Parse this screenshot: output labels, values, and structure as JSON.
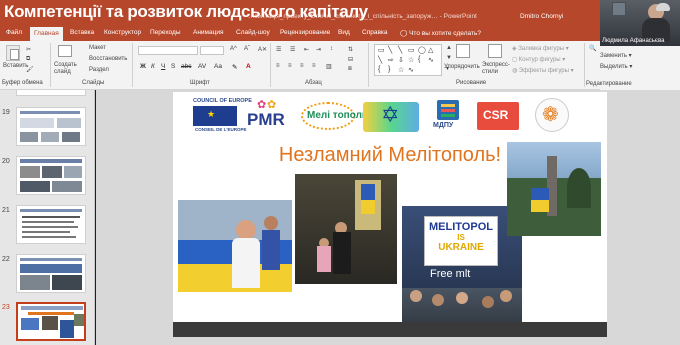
{
  "meeting": {
    "title": "Компетенції та розвиток людського капіталу"
  },
  "titlebar": {
    "doc_title": "…зентація_проекту_Етнічні_спільноти_і_спільність_запоруж… - PowerPoint",
    "user": "Dmitro Chornyi",
    "controls": [
      "–",
      "□",
      "✕"
    ]
  },
  "webcam": {
    "participant": "Людмила Афанасьєва"
  },
  "tabs": [
    {
      "label": "Файл"
    },
    {
      "label": "Главная"
    },
    {
      "label": "Вставка"
    },
    {
      "label": "Конструктор"
    },
    {
      "label": "Переходы"
    },
    {
      "label": "Анимация"
    },
    {
      "label": "Слайд-шоу"
    },
    {
      "label": "Рецензирование"
    },
    {
      "label": "Вид"
    },
    {
      "label": "Справка"
    },
    {
      "label": "Что вы хотите сделать?"
    }
  ],
  "ribbon": {
    "clipboard": {
      "paste": "Вставить",
      "group": "Буфер обмена"
    },
    "slides": {
      "new": "Создать слайд",
      "layout": "Макет",
      "reset": "Восстановить",
      "section": "Раздел",
      "group": "Слайды"
    },
    "font": {
      "group": "Шрифт",
      "buttons": [
        "Ж",
        "К",
        "Ч",
        "S",
        "abc",
        "AV",
        "Aa"
      ]
    },
    "paragraph": {
      "group": "Абзац"
    },
    "drawing": {
      "arrange": "Упорядочить",
      "styles": "Экспресс-стили",
      "fill": "Заливка фигуры",
      "outline": "Контур фигуры",
      "effects": "Эффекты фигуры",
      "group": "Рисование"
    },
    "editing": {
      "find": "Найти",
      "replace": "Заменить",
      "select": "Выделить",
      "group": "Редактирование"
    }
  },
  "thumbnails": [
    {
      "number": "19",
      "current": false
    },
    {
      "number": "20",
      "current": false
    },
    {
      "number": "21",
      "current": false
    },
    {
      "number": "22",
      "current": false
    },
    {
      "number": "23",
      "current": true
    }
  ],
  "slide": {
    "heading": "Незламний Мелітополь!",
    "logos": {
      "council": "COUNCIL OF EUROPE",
      "council_fr": "CONSEIL DE L'EUROPE",
      "pmr": "PMR",
      "melitopol": "Мелі тополь",
      "mdtv": "МДПУ",
      "csr": "CSR"
    },
    "photo_sign": {
      "line1": "MELITOPOL",
      "line2": "IS",
      "line3": "UKRAINE"
    },
    "photo_caption": "Free mlt"
  },
  "colors": {
    "accent": "#b7472a",
    "heading": "#e0741f",
    "current_slide": "#c43e1c"
  }
}
